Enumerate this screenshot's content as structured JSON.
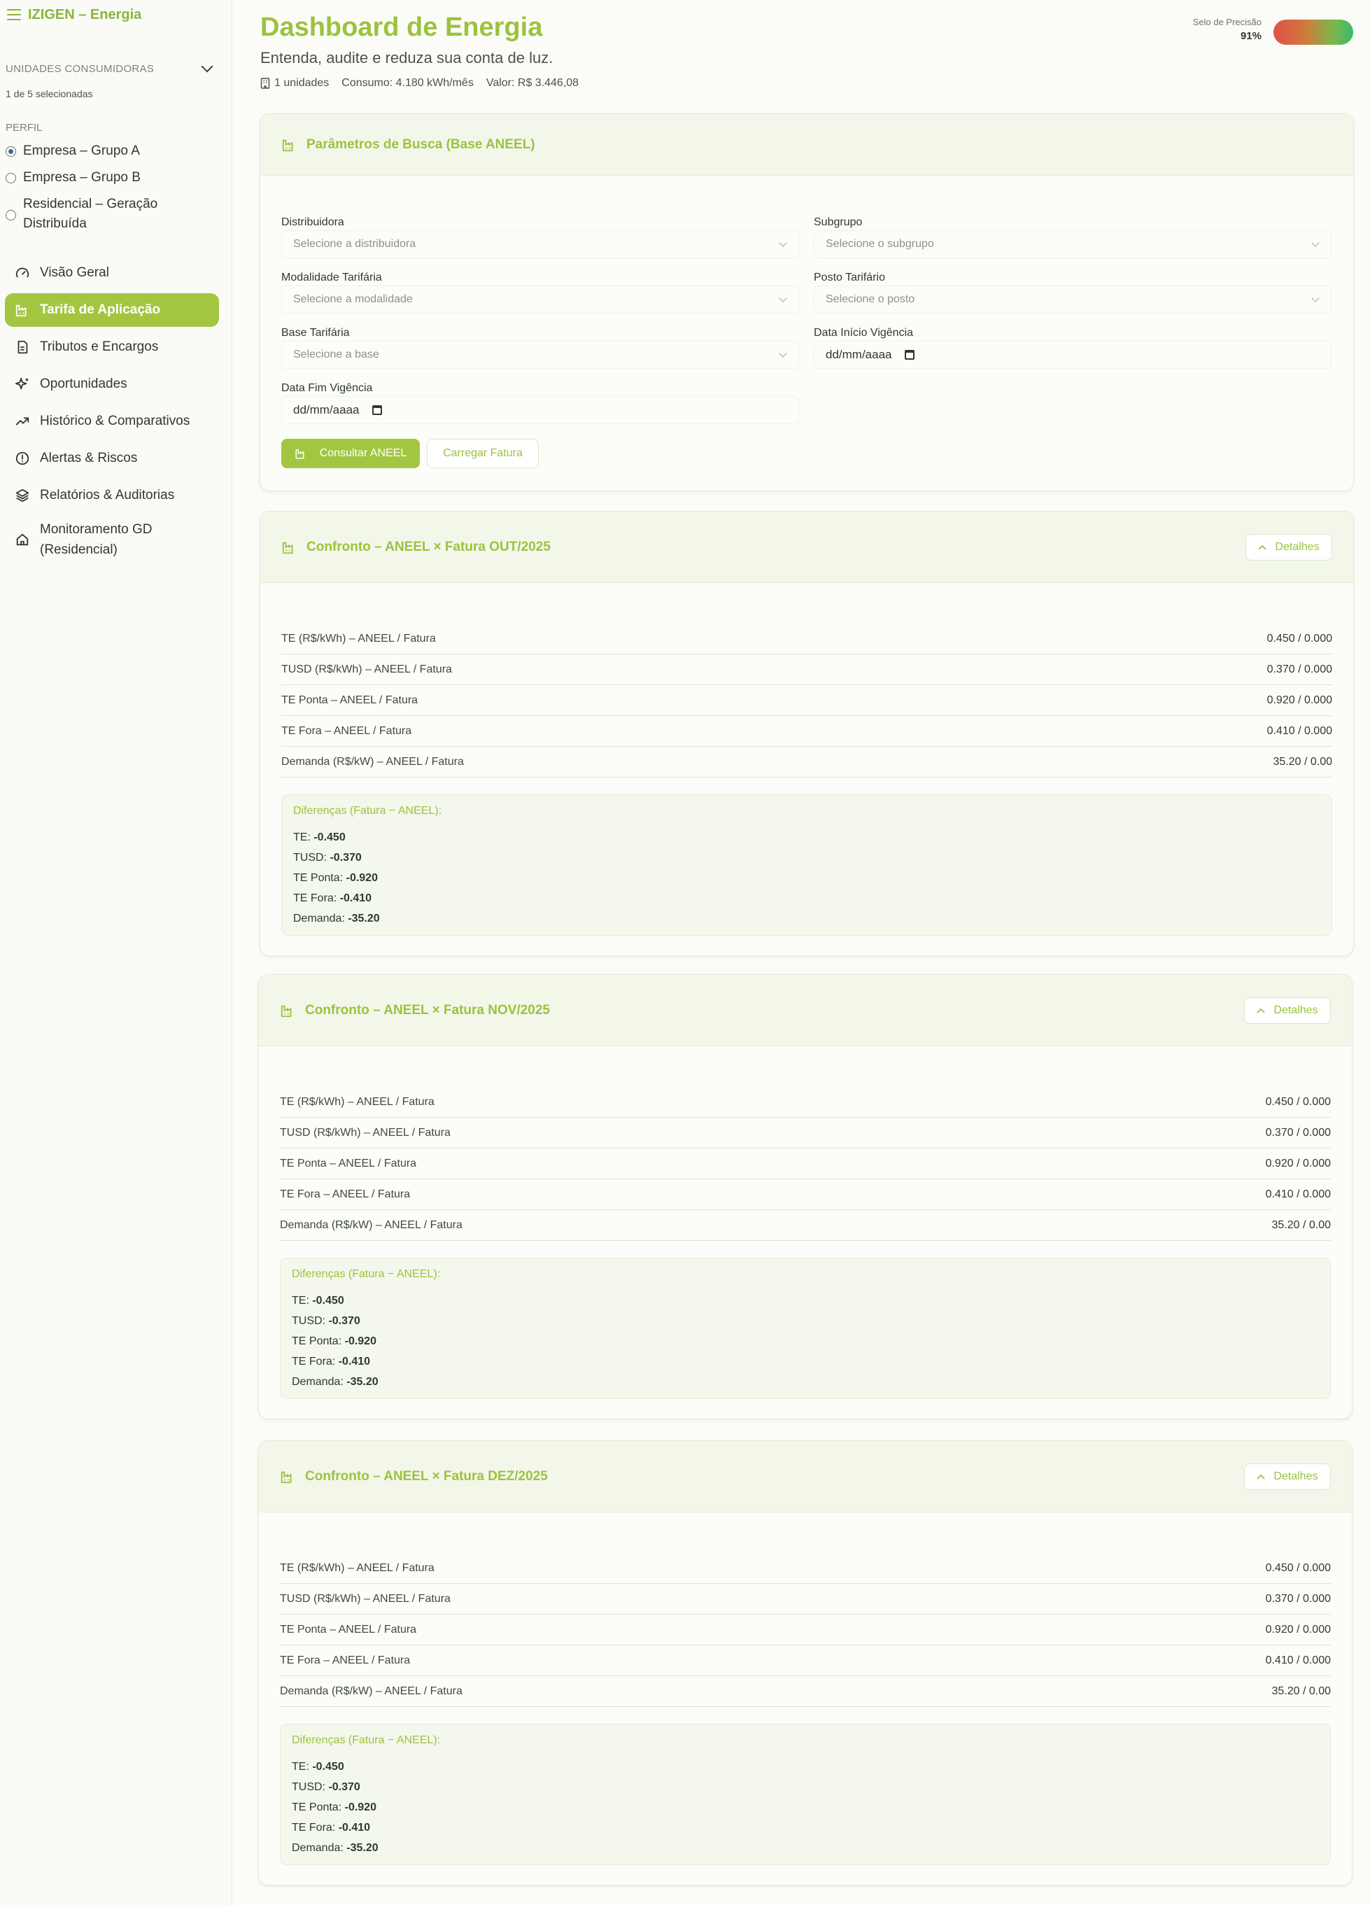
{
  "brand": {
    "name": "IZIGEN – Energia"
  },
  "sidebar": {
    "units_label": "UNIDADES CONSUMIDORAS",
    "units_selected": "1 de 5 selecionadas",
    "perfil_label": "PERFIL",
    "perfis": [
      {
        "label": "Empresa – Grupo A",
        "selected": true
      },
      {
        "label": "Empresa – Grupo B",
        "selected": false
      },
      {
        "label": "Residencial – Geração Distribuída",
        "selected": false
      }
    ],
    "nav": [
      {
        "label": "Visão Geral",
        "icon": "gauge-icon"
      },
      {
        "label": "Tarifa de Aplicação",
        "icon": "factory-icon",
        "active": true
      },
      {
        "label": "Tributos e Encargos",
        "icon": "document-icon"
      },
      {
        "label": "Oportunidades",
        "icon": "sparkles-icon"
      },
      {
        "label": "Histórico & Comparativos",
        "icon": "trending-up-icon"
      },
      {
        "label": "Alertas & Riscos",
        "icon": "alert-circle-icon"
      },
      {
        "label": "Relatórios & Auditorias",
        "icon": "layers-icon"
      },
      {
        "label": "Monitoramento GD (Residencial)",
        "icon": "home-icon"
      }
    ]
  },
  "header": {
    "title": "Dashboard de Energia",
    "subtitle": "Entenda, audite e reduza sua conta de luz.",
    "units": "1 unidades",
    "consumo": "Consumo: 4.180 kWh/mês",
    "valor": "Valor: R$ 3.446,08",
    "precision_label": "Selo de Precisão",
    "precision_value": "91%",
    "precision_fraction": 0.91
  },
  "search": {
    "title": "Parâmetros de Busca (Base ANEEL)",
    "fields": {
      "distribuidora": {
        "label": "Distribuidora",
        "placeholder": "Selecione a distribuidora"
      },
      "subgrupo": {
        "label": "Subgrupo",
        "placeholder": "Selecione o subgrupo"
      },
      "modalidade": {
        "label": "Modalidade Tarifária",
        "placeholder": "Selecione a modalidade"
      },
      "posto": {
        "label": "Posto Tarifário",
        "placeholder": "Selecione o posto"
      },
      "base": {
        "label": "Base Tarifária",
        "placeholder": "Selecione a base"
      },
      "inicio": {
        "label": "Data Início Vigência",
        "value": "dd/mm/aaaa"
      },
      "fim": {
        "label": "Data Fim Vigência",
        "value": "dd/mm/aaaa"
      }
    },
    "consult_btn": "Consultar ANEEL",
    "load_btn": "Carregar Fatura"
  },
  "confrontos": [
    {
      "title": "Confronto – ANEEL × Fatura OUT/2025",
      "details_btn": "Detalhes",
      "rows": [
        {
          "label": "TE (R$/kWh) – ANEEL / Fatura",
          "value": "0.450 / 0.000"
        },
        {
          "label": "TUSD (R$/kWh) – ANEEL / Fatura",
          "value": "0.370 / 0.000"
        },
        {
          "label": "TE Ponta – ANEEL / Fatura",
          "value": "0.920 / 0.000"
        },
        {
          "label": "TE Fora – ANEEL / Fatura",
          "value": "0.410 / 0.000"
        },
        {
          "label": "Demanda (R$/kW) – ANEEL / Fatura",
          "value": "35.20 / 0.00"
        }
      ],
      "diff_title": "Diferenças (Fatura − ANEEL):",
      "diffs": [
        {
          "k": "TE:",
          "v": "-0.450"
        },
        {
          "k": "TUSD:",
          "v": "-0.370"
        },
        {
          "k": "TE Ponta:",
          "v": "-0.920"
        },
        {
          "k": "TE Fora:",
          "v": "-0.410"
        },
        {
          "k": "Demanda:",
          "v": "-35.20"
        }
      ]
    },
    {
      "title": "Confronto – ANEEL × Fatura NOV/2025",
      "details_btn": "Detalhes",
      "rows": [
        {
          "label": "TE (R$/kWh) – ANEEL / Fatura",
          "value": "0.450 / 0.000"
        },
        {
          "label": "TUSD (R$/kWh) – ANEEL / Fatura",
          "value": "0.370 / 0.000"
        },
        {
          "label": "TE Ponta – ANEEL / Fatura",
          "value": "0.920 / 0.000"
        },
        {
          "label": "TE Fora – ANEEL / Fatura",
          "value": "0.410 / 0.000"
        },
        {
          "label": "Demanda (R$/kW) – ANEEL / Fatura",
          "value": "35.20 / 0.00"
        }
      ],
      "diff_title": "Diferenças (Fatura − ANEEL):",
      "diffs": [
        {
          "k": "TE:",
          "v": "-0.450"
        },
        {
          "k": "TUSD:",
          "v": "-0.370"
        },
        {
          "k": "TE Ponta:",
          "v": "-0.920"
        },
        {
          "k": "TE Fora:",
          "v": "-0.410"
        },
        {
          "k": "Demanda:",
          "v": "-35.20"
        }
      ]
    },
    {
      "title": "Confronto – ANEEL × Fatura DEZ/2025",
      "details_btn": "Detalhes",
      "rows": [
        {
          "label": "TE (R$/kWh) – ANEEL / Fatura",
          "value": "0.450 / 0.000"
        },
        {
          "label": "TUSD (R$/kWh) – ANEEL / Fatura",
          "value": "0.370 / 0.000"
        },
        {
          "label": "TE Ponta – ANEEL / Fatura",
          "value": "0.920 / 0.000"
        },
        {
          "label": "TE Fora – ANEEL / Fatura",
          "value": "0.410 / 0.000"
        },
        {
          "label": "Demanda (R$/kW) – ANEEL / Fatura",
          "value": "35.20 / 0.00"
        }
      ],
      "diff_title": "Diferenças (Fatura − ANEEL):",
      "diffs": [
        {
          "k": "TE:",
          "v": "-0.450"
        },
        {
          "k": "TUSD:",
          "v": "-0.370"
        },
        {
          "k": "TE Ponta:",
          "v": "-0.920"
        },
        {
          "k": "TE Fora:",
          "v": "-0.410"
        },
        {
          "k": "Demanda:",
          "v": "-35.20"
        }
      ]
    }
  ],
  "colors": {
    "accent": "#9cc23e",
    "active_nav": "#a3c640"
  }
}
